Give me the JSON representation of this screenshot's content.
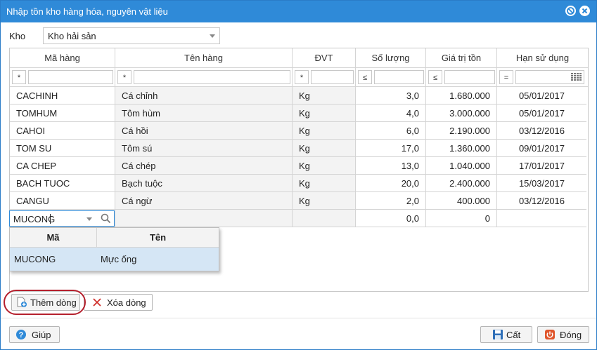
{
  "window": {
    "title": "Nhập tồn kho hàng hóa, nguyên vật liệu"
  },
  "kho": {
    "label": "Kho",
    "value": "Kho hải sản"
  },
  "grid": {
    "columns": [
      "Mã hàng",
      "Tên hàng",
      "ĐVT",
      "Số lượng",
      "Giá trị tồn",
      "Hạn sử dụng"
    ],
    "filters": [
      {
        "op": "*"
      },
      {
        "op": "*"
      },
      {
        "op": "*"
      },
      {
        "op": "≤"
      },
      {
        "op": "≤"
      },
      {
        "op": "="
      }
    ],
    "rows": [
      {
        "ma": "CACHINH",
        "ten": "Cá chỉnh",
        "dvt": "Kg",
        "sl": "3,0",
        "gt": "1.680.000",
        "hsd": "05/01/2017"
      },
      {
        "ma": "TOMHUM",
        "ten": "Tôm hùm",
        "dvt": "Kg",
        "sl": "4,0",
        "gt": "3.000.000",
        "hsd": "05/01/2017"
      },
      {
        "ma": "CAHOI",
        "ten": "Cá hồi",
        "dvt": "Kg",
        "sl": "6,0",
        "gt": "2.190.000",
        "hsd": "03/12/2016"
      },
      {
        "ma": "TOM SU",
        "ten": "Tôm sú",
        "dvt": "Kg",
        "sl": "17,0",
        "gt": "1.360.000",
        "hsd": "09/01/2017"
      },
      {
        "ma": "CA CHEP",
        "ten": "Cá chép",
        "dvt": "Kg",
        "sl": "13,0",
        "gt": "1.040.000",
        "hsd": "17/01/2017"
      },
      {
        "ma": "BACH TUOC",
        "ten": "Bạch tuộc",
        "dvt": "Kg",
        "sl": "20,0",
        "gt": "2.400.000",
        "hsd": "15/03/2017"
      },
      {
        "ma": "CANGU",
        "ten": "Cá ngừ",
        "dvt": "Kg",
        "sl": "2,0",
        "gt": "400.000",
        "hsd": "03/12/2016"
      }
    ],
    "edit_row": {
      "ma": "MUCONG",
      "sl": "0,0",
      "gt": "0"
    }
  },
  "dropdown": {
    "headers": [
      "Mã",
      "Tên"
    ],
    "items": [
      {
        "ma": "MUCONG",
        "ten": "Mực ống"
      }
    ]
  },
  "buttons": {
    "add_row": "Thêm dòng",
    "delete_row": "Xóa dòng",
    "help": "Giúp",
    "save": "Cất",
    "close": "Đóng"
  },
  "colors": {
    "title_bar": "#2f8ad8",
    "highlight": "#b5202d",
    "selected_row": "#d5e6f5"
  }
}
